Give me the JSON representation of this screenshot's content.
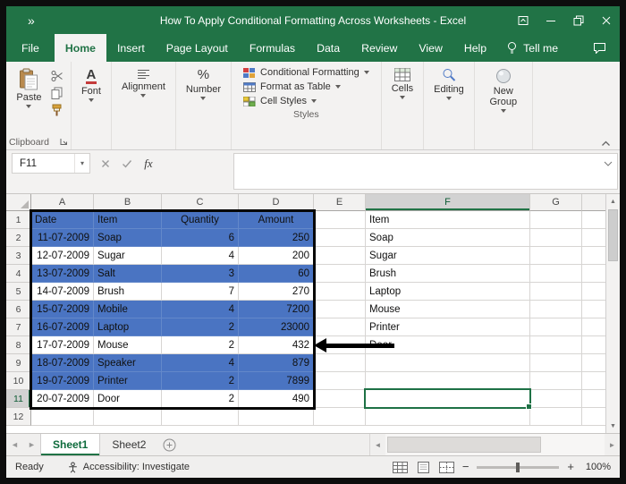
{
  "window": {
    "title": "How To Apply Conditional Formatting Across Worksheets - Excel"
  },
  "tabs": {
    "items": [
      "File",
      "Home",
      "Insert",
      "Page Layout",
      "Formulas",
      "Data",
      "Review",
      "View",
      "Help"
    ],
    "tell_me": "Tell me"
  },
  "ribbon": {
    "paste_label": "Paste",
    "font_label": "Font",
    "alignment_label": "Alignment",
    "number_label": "Number",
    "conditional_formatting_label": "Conditional Formatting",
    "format_as_table_label": "Format as Table",
    "cell_styles_label": "Cell Styles",
    "cells_label": "Cells",
    "editing_label": "Editing",
    "new_group_label": "New Group",
    "clipboard_group_label": "Clipboard",
    "styles_group_label": "Styles"
  },
  "formula_bar": {
    "name_box": "F11",
    "fx_label": "fx",
    "formula_value": ""
  },
  "grid": {
    "column_headers": [
      "A",
      "B",
      "C",
      "D",
      "E",
      "F",
      "G"
    ],
    "row_numbers": [
      "1",
      "2",
      "3",
      "4",
      "5",
      "6",
      "7",
      "8",
      "9",
      "10",
      "11",
      "12"
    ],
    "selected_cell": "F11",
    "selected_column": "F",
    "selected_row": "11"
  },
  "table": {
    "range": "A1:D11",
    "headers": [
      "Date",
      "Item",
      "Quantity",
      "Amount"
    ],
    "rows": [
      [
        "11-07-2009",
        "Soap",
        "6",
        "250"
      ],
      [
        "12-07-2009",
        "Sugar",
        "4",
        "200"
      ],
      [
        "13-07-2009",
        "Salt",
        "3",
        "60"
      ],
      [
        "14-07-2009",
        "Brush",
        "7",
        "270"
      ],
      [
        "15-07-2009",
        "Mobile",
        "4",
        "7200"
      ],
      [
        "16-07-2009",
        "Laptop",
        "2",
        "23000"
      ],
      [
        "17-07-2009",
        "Mouse",
        "2",
        "432"
      ],
      [
        "18-07-2009",
        "Speaker",
        "4",
        "879"
      ],
      [
        "19-07-2009",
        "Printer",
        "2",
        "7899"
      ],
      [
        "20-07-2009",
        "Door",
        "2",
        "490"
      ]
    ],
    "highlighted_sheet_rows": [
      "1",
      "2",
      "4",
      "6",
      "7",
      "9",
      "10"
    ]
  },
  "f_column": [
    "Item",
    "Soap",
    "Sugar",
    "Brush",
    "Laptop",
    "Mouse",
    "Printer",
    "Door"
  ],
  "sheet_bar": {
    "sheet1": "Sheet1",
    "sheet2": "Sheet2"
  },
  "status_bar": {
    "ready": "Ready",
    "accessibility": "Accessibility: Investigate",
    "zoom_level": "100%"
  },
  "colors": {
    "excel_green": "#217346",
    "highlight_blue": "#4A74C2",
    "selection_green": "#1E7145"
  }
}
